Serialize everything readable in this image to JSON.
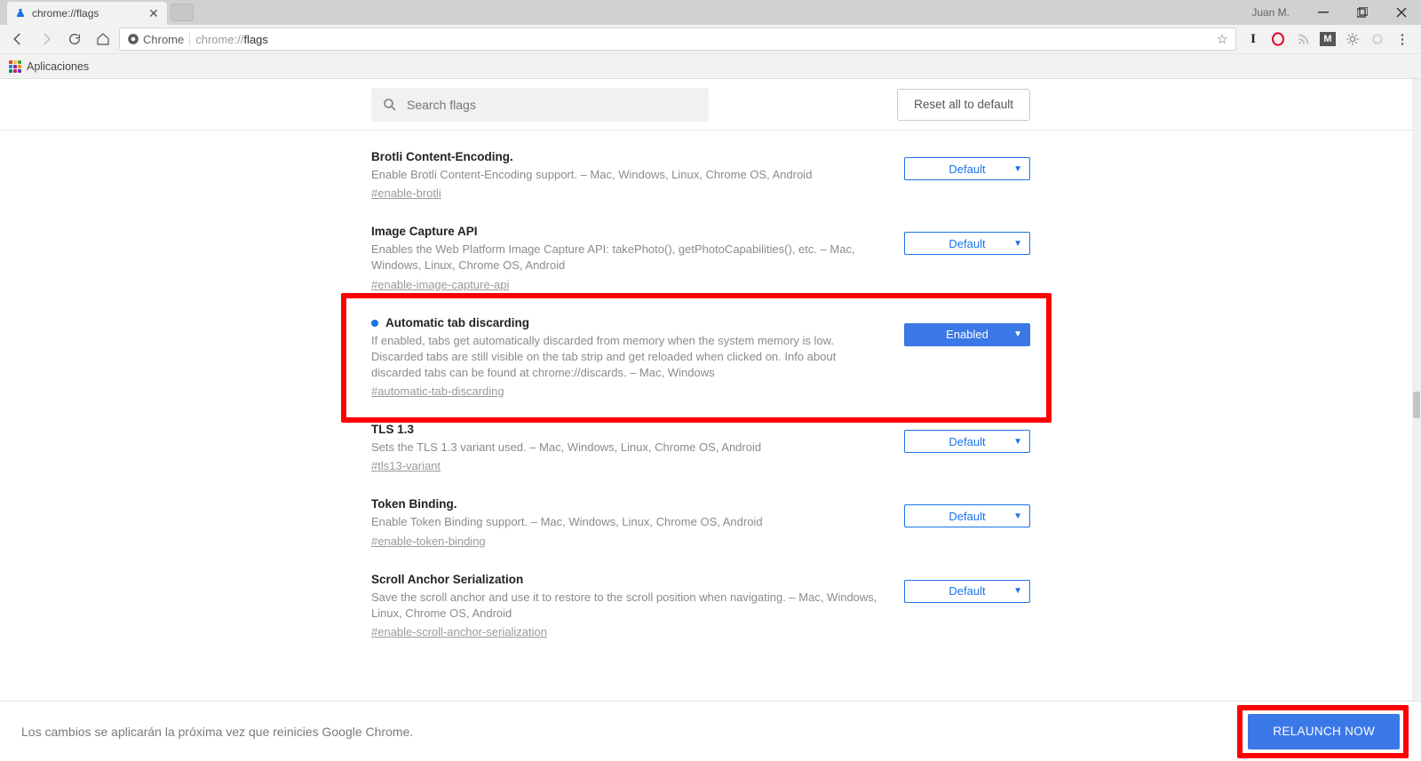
{
  "window": {
    "user": "Juan M.",
    "tab_title": "chrome://flags"
  },
  "address_bar": {
    "secure_label": "Chrome",
    "url_prefix": "chrome://",
    "url_rest": "flags"
  },
  "bookmarks": {
    "apps": "Aplicaciones"
  },
  "header": {
    "search_placeholder": "Search flags",
    "reset_label": "Reset all to default"
  },
  "flags": [
    {
      "title": "Brotli Content-Encoding.",
      "description": "Enable Brotli Content-Encoding support. – Mac, Windows, Linux, Chrome OS, Android",
      "anchor": "#enable-brotli",
      "value": "Default",
      "highlighted": false,
      "enabled": false
    },
    {
      "title": "Image Capture API",
      "description": "Enables the Web Platform Image Capture API: takePhoto(), getPhotoCapabilities(), etc. – Mac, Windows, Linux, Chrome OS, Android",
      "anchor": "#enable-image-capture-api",
      "value": "Default",
      "highlighted": false,
      "enabled": false
    },
    {
      "title": "Automatic tab discarding",
      "description": "If enabled, tabs get automatically discarded from memory when the system memory is low. Discarded tabs are still visible on the tab strip and get reloaded when clicked on. Info about discarded tabs can be found at chrome://discards. – Mac, Windows",
      "anchor": "#automatic-tab-discarding",
      "value": "Enabled",
      "highlighted": true,
      "enabled": true
    },
    {
      "title": "TLS 1.3",
      "description": "Sets the TLS 1.3 variant used. – Mac, Windows, Linux, Chrome OS, Android",
      "anchor": "#tls13-variant",
      "value": "Default",
      "highlighted": false,
      "enabled": false
    },
    {
      "title": "Token Binding.",
      "description": "Enable Token Binding support. – Mac, Windows, Linux, Chrome OS, Android",
      "anchor": "#enable-token-binding",
      "value": "Default",
      "highlighted": false,
      "enabled": false
    },
    {
      "title": "Scroll Anchor Serialization",
      "description": "Save the scroll anchor and use it to restore to the scroll position when navigating. – Mac, Windows, Linux, Chrome OS, Android",
      "anchor": "#enable-scroll-anchor-serialization",
      "value": "Default",
      "highlighted": false,
      "enabled": false
    }
  ],
  "footer": {
    "message": "Los cambios se aplicarán la próxima vez que reinicies Google Chrome.",
    "relaunch": "RELAUNCH NOW"
  },
  "colors": {
    "accent": "#1a73e8",
    "highlight": "#ff0000",
    "button_primary": "#3b78e7"
  }
}
